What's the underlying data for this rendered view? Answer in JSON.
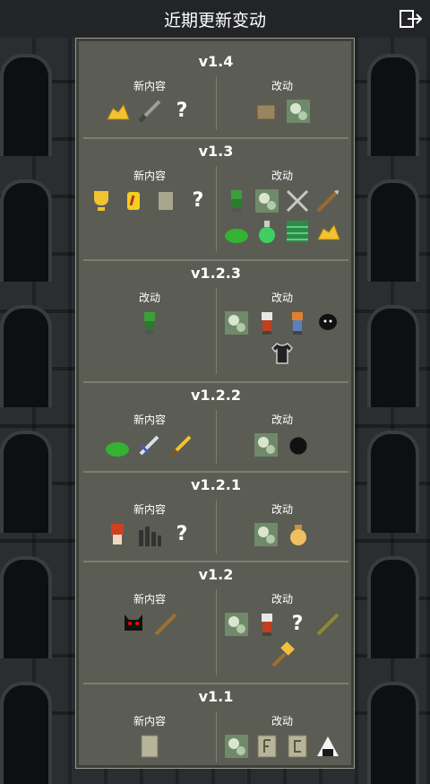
{
  "header": {
    "title": "近期更新变动"
  },
  "sections": [
    {
      "version": "v1.4",
      "left": {
        "label": "新内容",
        "icons": [
          "gold-pile-icon",
          "dagger-icon",
          "unknown-item-icon"
        ]
      },
      "right": {
        "label": "改动",
        "icons": [
          "box-icon",
          "dungeon-map-icon"
        ]
      }
    },
    {
      "version": "v1.3",
      "left": {
        "label": "新内容",
        "icons": [
          "trophy-icon",
          "gem-badge-icon",
          "stone-tablet-icon",
          "unknown-item-icon"
        ]
      },
      "right": {
        "label": "改动",
        "icons": [
          "huntress-icon",
          "dungeon-map-icon",
          "crossed-swords-icon",
          "spear-icon",
          "green-slime-icon",
          "potion-icon",
          "green-grass-icon",
          "gold-pile-icon"
        ]
      }
    },
    {
      "version": "v1.2.3",
      "left": {
        "label": "改动",
        "icons": [
          "huntress-icon"
        ]
      },
      "right": {
        "label": "改动",
        "icons": [
          "dungeon-map-icon",
          "priest-icon",
          "warrior-icon",
          "shadow-creature-icon",
          "shirt-icon"
        ]
      }
    },
    {
      "version": "v1.2.2",
      "left": {
        "label": "新内容",
        "icons": [
          "green-slime-icon",
          "sword-icon",
          "golden-sword-icon"
        ]
      },
      "right": {
        "label": "改动",
        "icons": [
          "dungeon-map-icon",
          "bomb-icon"
        ]
      }
    },
    {
      "version": "v1.2.1",
      "left": {
        "label": "新内容",
        "icons": [
          "red-haired-girl-icon",
          "dark-columns-icon",
          "unknown-item-icon"
        ]
      },
      "right": {
        "label": "改动",
        "icons": [
          "dungeon-map-icon",
          "honey-pot-icon"
        ]
      }
    },
    {
      "version": "v1.2",
      "left": {
        "label": "新内容",
        "icons": [
          "black-cat-icon",
          "staff-icon"
        ]
      },
      "right": {
        "label": "改动",
        "icons": [
          "dungeon-map-icon",
          "priest-icon",
          "unknown-item-icon",
          "spear-icon",
          "hammer-icon"
        ]
      }
    },
    {
      "version": "v1.1",
      "left": {
        "label": "新内容",
        "icons": [
          "scroll-icon"
        ]
      },
      "right": {
        "label": "改动",
        "icons": [
          "dungeon-map-icon",
          "rune-tablet-f-icon",
          "rune-tablet-c-icon",
          "rice-ball-icon"
        ]
      }
    }
  ],
  "colors": {
    "panel": "#5b5d54",
    "divider": "#7c7e72",
    "header": "#222427"
  }
}
